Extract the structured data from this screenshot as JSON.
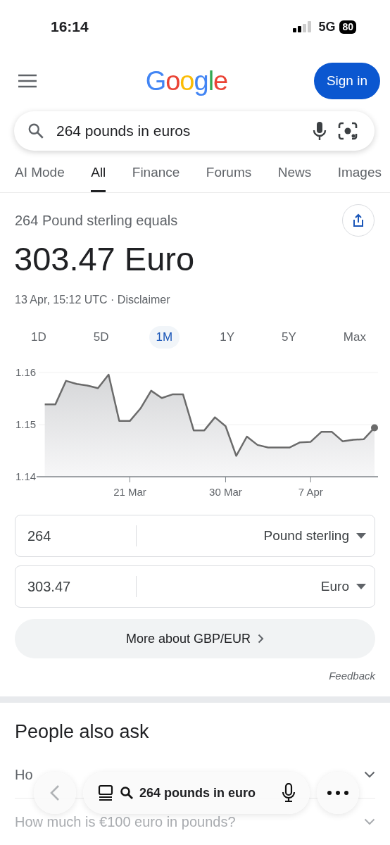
{
  "status_bar": {
    "time": "16:14",
    "network": "5G",
    "battery": "80"
  },
  "header": {
    "logo": "Google",
    "sign_in": "Sign in"
  },
  "search": {
    "value": "264 pounds in euros"
  },
  "tabs": [
    {
      "label": "AI Mode",
      "selected": false
    },
    {
      "label": "All",
      "selected": true
    },
    {
      "label": "Finance",
      "selected": false
    },
    {
      "label": "Forums",
      "selected": false
    },
    {
      "label": "News",
      "selected": false
    },
    {
      "label": "Images",
      "selected": false
    }
  ],
  "result": {
    "caption": "264 Pound sterling equals",
    "value": "303.47 Euro",
    "timestamp": "13 Apr, 15:12 UTC · ",
    "disclaimer": "Disclaimer"
  },
  "ranges": [
    {
      "label": "1D",
      "selected": false
    },
    {
      "label": "5D",
      "selected": false
    },
    {
      "label": "1M",
      "selected": true
    },
    {
      "label": "1Y",
      "selected": false
    },
    {
      "label": "5Y",
      "selected": false
    },
    {
      "label": "Max",
      "selected": false
    }
  ],
  "chart_data": {
    "type": "area",
    "categories": [
      null,
      null,
      null,
      null,
      null,
      null,
      null,
      null,
      "21 Mar",
      null,
      null,
      null,
      null,
      null,
      null,
      null,
      null,
      "30 Mar",
      null,
      null,
      null,
      null,
      null,
      null,
      null,
      "7 Apr",
      null,
      null,
      null,
      null,
      null,
      null
    ],
    "series": [
      {
        "color": "#6b6b6b",
        "values": [
          1.1539,
          1.1539,
          1.1584,
          1.1578,
          1.1575,
          1.157,
          1.1596,
          1.1507,
          1.1507,
          1.1531,
          1.1565,
          1.1551,
          1.1558,
          1.1558,
          1.1489,
          1.1489,
          1.1514,
          1.1497,
          1.144,
          1.1477,
          1.1461,
          1.1456,
          1.1456,
          1.1456,
          1.1466,
          1.1467,
          1.1486,
          1.1486,
          1.1468,
          1.1471,
          1.1472,
          1.1494
        ]
      }
    ],
    "ylim": [
      1.14,
      1.16
    ],
    "yticks": [
      {
        "value": 1.16,
        "label": "1.16"
      },
      {
        "value": 1.15,
        "label": "1.15"
      },
      {
        "value": 1.14,
        "label": "1.14"
      }
    ]
  },
  "converter": [
    {
      "amount": "264",
      "currency": "Pound sterling"
    },
    {
      "amount": "303.47",
      "currency": "Euro"
    }
  ],
  "more_button": "More about GBP/EUR",
  "feedback": "Feedback",
  "people_also_ask": {
    "title": "People also ask",
    "questions": [
      {
        "text": "Ho",
        "faded": false
      },
      {
        "text": "How much is €100 euro in pounds?",
        "faded": true
      }
    ]
  },
  "bottom_bar": {
    "query": "264 pounds in euro"
  }
}
